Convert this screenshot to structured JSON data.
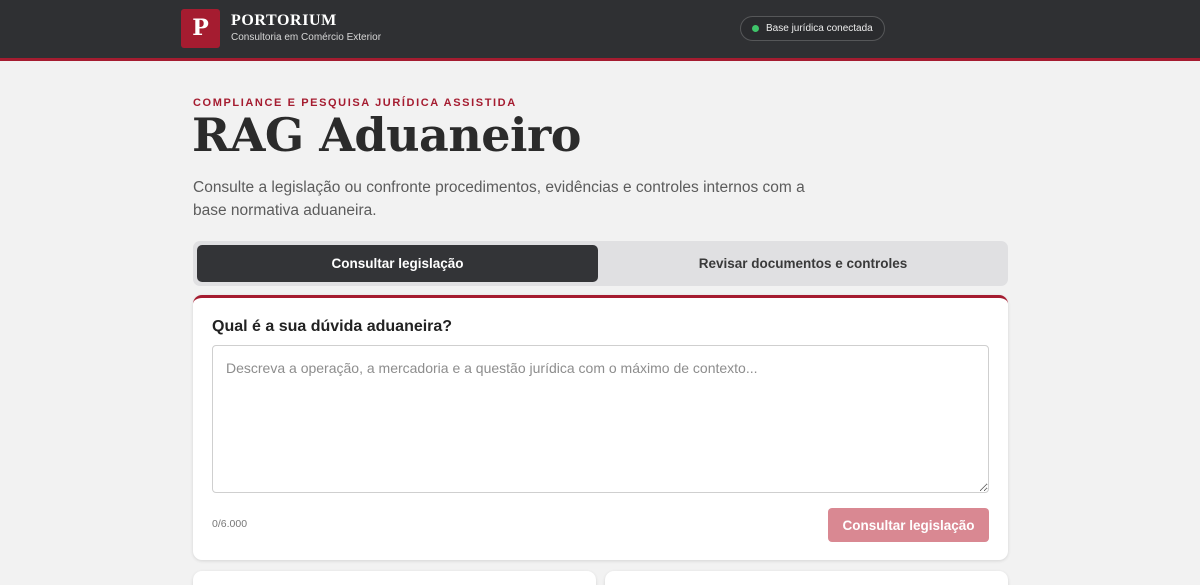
{
  "header": {
    "logo_letter": "P",
    "brand_name": "PORTORIUM",
    "brand_subtitle": "Consultoria em Comércio Exterior",
    "status_text": "Base jurídica conectada",
    "accent_color": "#a51c30",
    "status_color": "#3fc46a"
  },
  "hero": {
    "eyebrow": "COMPLIANCE E PESQUISA JURÍDICA ASSISTIDA",
    "title": "RAG Aduaneiro",
    "description": "Consulte a legislação ou confronte procedimentos, evidências e controles internos com a base normativa aduaneira."
  },
  "tabs": [
    {
      "label": "Consultar legislação",
      "active": true
    },
    {
      "label": "Revisar documentos e controles",
      "active": false
    }
  ],
  "form": {
    "question_label": "Qual é a sua dúvida aduaneira?",
    "textarea_value": "",
    "textarea_placeholder": "Descreva a operação, a mercadoria e a questão jurídica com o máximo de contexto...",
    "char_count": "0/6.000",
    "submit_label": "Consultar legislação"
  }
}
